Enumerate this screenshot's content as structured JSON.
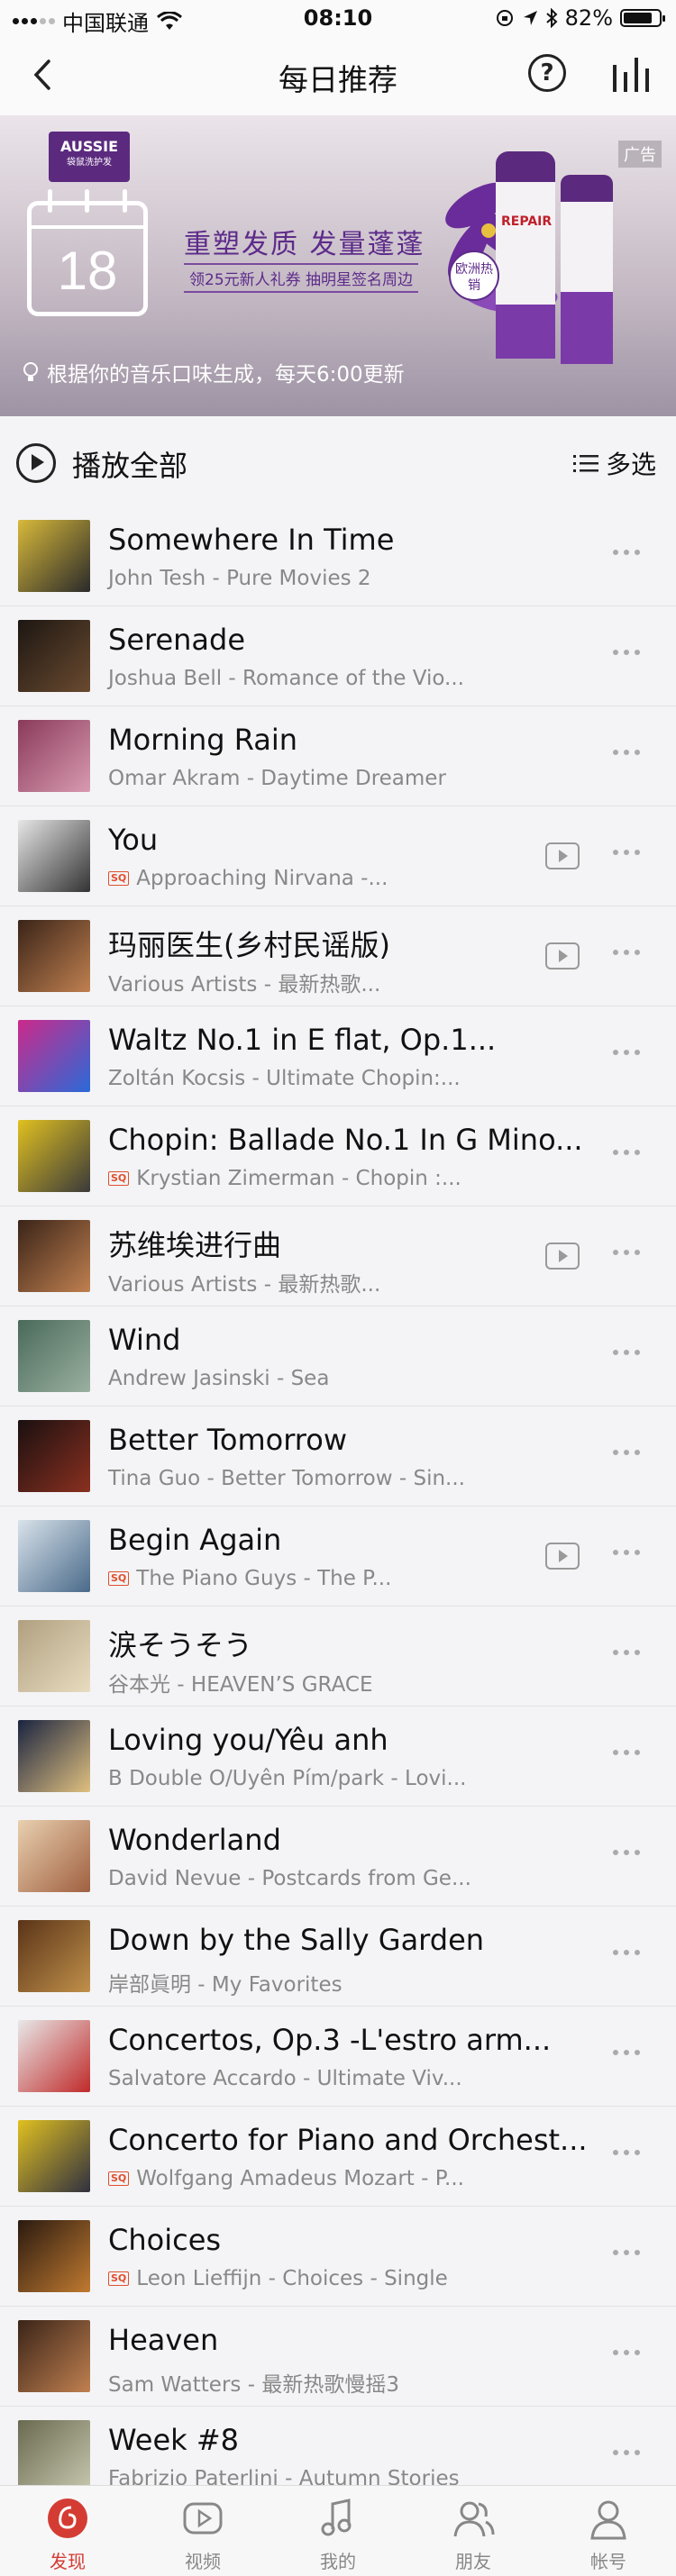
{
  "status_bar": {
    "carrier": "中国联通",
    "time": "08:10",
    "battery": "82%",
    "battery_level": 0.82
  },
  "nav": {
    "title": "每日推荐",
    "help_label": "?"
  },
  "banner": {
    "brand_name": "AUSSIE",
    "brand_sub": "袋鼠洗护发",
    "calendar_day": "18",
    "headline": "重塑发质 发量蓬蓬",
    "subline": "领25元新人礼券 抽明星签名周边",
    "product_label": "REPAIR",
    "badge": "欧洲热销",
    "ad_tag": "广告",
    "refresh_note": "根据你的音乐口味生成，每天6:00更新"
  },
  "playall": {
    "label": "播放全部",
    "multi_select": "多选"
  },
  "songs": [
    {
      "title": "Somewhere In Time",
      "subtitle": "John Tesh - Pure Movies 2",
      "sq": false,
      "mv": false,
      "cover": [
        "#d8b93a",
        "#2a2a2a"
      ]
    },
    {
      "title": "Serenade",
      "subtitle": "Joshua Bell - Romance of the Vio...",
      "sq": false,
      "mv": false,
      "cover": [
        "#1d1712",
        "#6a4a30"
      ]
    },
    {
      "title": "Morning Rain",
      "subtitle": "Omar Akram - Daytime Dreamer",
      "sq": false,
      "mv": false,
      "cover": [
        "#8a3a5a",
        "#d89ab0"
      ]
    },
    {
      "title": "You",
      "subtitle": "Approaching Nirvana -...",
      "sq": true,
      "mv": true,
      "cover": [
        "#e6e6e6",
        "#333333"
      ]
    },
    {
      "title": "玛丽医生(乡村民谣版)",
      "subtitle": "Various Artists - 最新热歌...",
      "sq": false,
      "mv": true,
      "cover": [
        "#3a2418",
        "#c08050"
      ]
    },
    {
      "title": "Waltz No.1 in E flat, Op.1...",
      "subtitle": "Zoltán Kocsis - Ultimate Chopin:...",
      "sq": false,
      "mv": false,
      "cover": [
        "#cc2a8a",
        "#2a6ad8"
      ]
    },
    {
      "title": "Chopin: Ballade No.1 In G Mino...",
      "subtitle": "Krystian Zimerman - Chopin :...",
      "sq": true,
      "mv": false,
      "cover": [
        "#e0c020",
        "#3a3a3a"
      ]
    },
    {
      "title": "苏维埃进行曲",
      "subtitle": "Various Artists - 最新热歌...",
      "sq": false,
      "mv": true,
      "cover": [
        "#3a2418",
        "#c08050"
      ]
    },
    {
      "title": "Wind",
      "subtitle": "Andrew Jasinski - Sea",
      "sq": false,
      "mv": false,
      "cover": [
        "#4a6a5a",
        "#9ab0a0"
      ]
    },
    {
      "title": "Better Tomorrow",
      "subtitle": "Tina Guo - Better Tomorrow - Sin...",
      "sq": false,
      "mv": false,
      "cover": [
        "#1a1010",
        "#8a3020"
      ]
    },
    {
      "title": "Begin Again",
      "subtitle": "The Piano Guys - The P...",
      "sq": true,
      "mv": true,
      "cover": [
        "#d8e2ea",
        "#4a6a8a"
      ]
    },
    {
      "title": "涙そうそう",
      "subtitle": "谷本光 - HEAVEN’S GRACE",
      "sq": false,
      "mv": false,
      "cover": [
        "#b0a080",
        "#e8dcc0"
      ]
    },
    {
      "title": "Loving you/Yêu anh",
      "subtitle": "B Double O/Uyên Pím/park - Lovi...",
      "sq": false,
      "mv": false,
      "cover": [
        "#1a2440",
        "#e0c080"
      ]
    },
    {
      "title": "Wonderland",
      "subtitle": "David Nevue - Postcards from Ge...",
      "sq": false,
      "mv": false,
      "cover": [
        "#e8d0b0",
        "#a06040"
      ]
    },
    {
      "title": "Down by the Sally Garden",
      "subtitle": "岸部眞明 - My Favorites",
      "sq": false,
      "mv": false,
      "cover": [
        "#5a3418",
        "#c0904a"
      ]
    },
    {
      "title": "Concertos, Op.3 -L'estro arm...",
      "subtitle": "Salvatore Accardo - Ultimate Viv...",
      "sq": false,
      "mv": false,
      "cover": [
        "#e8e8e8",
        "#c02a2a"
      ]
    },
    {
      "title": "Concerto for Piano and Orchest...",
      "subtitle": "Wolfgang Amadeus Mozart - P...",
      "sq": true,
      "mv": false,
      "cover": [
        "#e0c020",
        "#303040"
      ]
    },
    {
      "title": "Choices",
      "subtitle": "Leon Lieffijn - Choices - Single",
      "sq": true,
      "mv": false,
      "cover": [
        "#2a1a10",
        "#c07a30"
      ]
    },
    {
      "title": "Heaven",
      "subtitle": "Sam Watters - 最新热歌慢摇3",
      "sq": false,
      "mv": false,
      "cover": [
        "#3a2418",
        "#c08050"
      ]
    },
    {
      "title": "Week #8",
      "subtitle": "Fabrizio Paterlini - Autumn Stories",
      "sq": false,
      "mv": false,
      "cover": [
        "#6a6a50",
        "#c8c8b0"
      ]
    }
  ],
  "tabs": [
    {
      "label": "发现",
      "icon": "discover-icon",
      "active": true
    },
    {
      "label": "视频",
      "icon": "video-icon",
      "active": false
    },
    {
      "label": "我的",
      "icon": "music-note-icon",
      "active": false
    },
    {
      "label": "朋友",
      "icon": "friends-icon",
      "active": false
    },
    {
      "label": "帐号",
      "icon": "account-icon",
      "active": false
    }
  ],
  "colors": {
    "accent": "#d43c33",
    "ad_purple": "#5d2b8a",
    "sq_badge": "#e0502f"
  }
}
